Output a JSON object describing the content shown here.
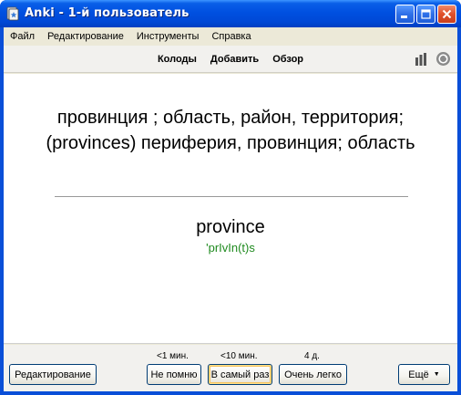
{
  "window": {
    "title": "Anki - 1-й пользователь",
    "controls": [
      "minimize-icon",
      "maximize-icon",
      "close-icon"
    ]
  },
  "menu": {
    "items": [
      {
        "label": "Файл"
      },
      {
        "label": "Редактирование"
      },
      {
        "label": "Инструменты"
      },
      {
        "label": "Справка"
      }
    ]
  },
  "toolbar": {
    "links": [
      {
        "label": "Колоды"
      },
      {
        "label": "Добавить"
      },
      {
        "label": "Обзор"
      }
    ],
    "icons": [
      "stats-icon",
      "sync-icon"
    ]
  },
  "card": {
    "question": "провинция ; область, район, территория; (provinces) периферия, провинция; область",
    "answer_word": "province",
    "answer_pronunciation": "'prIvIn(t)s",
    "pronunciation_color": "#1e8a1e"
  },
  "bottom": {
    "edit_label": "Редактирование",
    "answers": [
      {
        "interval": "<1 мин.",
        "label": "Не помню"
      },
      {
        "interval": "<10 мин.",
        "label": "В самый раз"
      },
      {
        "interval": "4 д.",
        "label": "Очень легко"
      }
    ],
    "more_label": "Ещё"
  },
  "colors": {
    "titlebar": "#0050e0",
    "client_bg": "#ece9d8"
  }
}
